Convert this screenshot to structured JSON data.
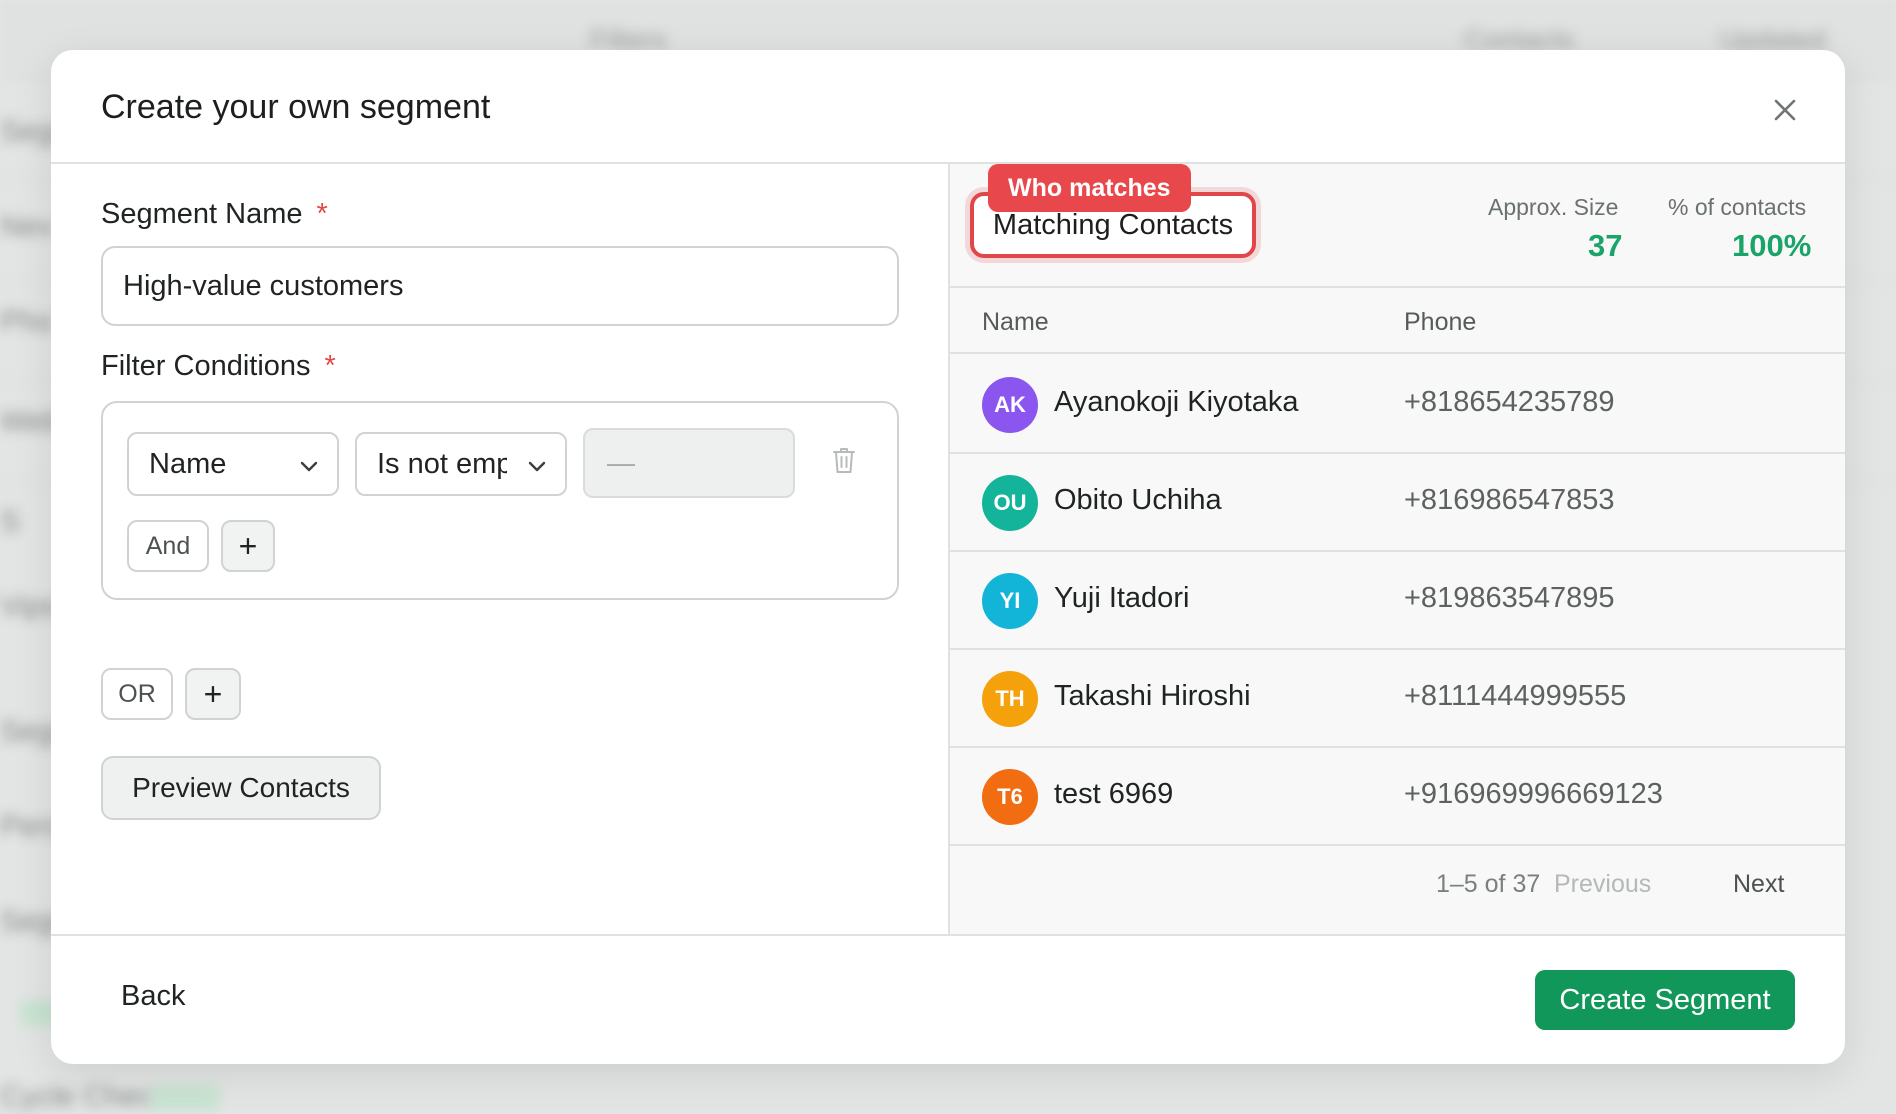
{
  "background": {
    "columns": [
      "Filters",
      "Contacts",
      "Updated"
    ],
    "rows": [
      "Segm",
      "Nev",
      "Pho",
      "Webs",
      "S",
      "Vips",
      "Segm",
      "Persc",
      "Segm",
      "Segm"
    ],
    "last_row_label": "Cycle Check"
  },
  "modal": {
    "title": "Create your own segment",
    "close_icon": "close-icon"
  },
  "form": {
    "segment_name_label": "Segment Name",
    "required_marker": "*",
    "segment_name_value": "High-value customers",
    "filter_conditions_label": "Filter Conditions",
    "condition": {
      "field": "Name",
      "operator": "Is not empty",
      "value_placeholder": "—"
    },
    "and_label": "And",
    "add_label": "+",
    "or_label": "OR",
    "preview_label": "Preview Contacts"
  },
  "results": {
    "tag": "Who matches",
    "title": "Matching Contacts",
    "approx_size_label": "Approx. Size",
    "approx_size_value": "37",
    "percent_label": "% of contacts",
    "percent_value": "100%",
    "columns": {
      "name": "Name",
      "phone": "Phone"
    },
    "contacts": [
      {
        "initials": "AK",
        "name": "Ayanokoji Kiyotaka",
        "phone": "+818654235789",
        "color": "#8b55f0"
      },
      {
        "initials": "OU",
        "name": "Obito Uchiha",
        "phone": "+816986547853",
        "color": "#14b49a"
      },
      {
        "initials": "YI",
        "name": "Yuji Itadori",
        "phone": "+819863547895",
        "color": "#12b4d8"
      },
      {
        "initials": "TH",
        "name": "Takashi Hiroshi",
        "phone": "+8111444999555",
        "color": "#f5a10c"
      },
      {
        "initials": "T6",
        "name": "test 6969",
        "phone": "+916969996669123",
        "color": "#f26c12"
      }
    ],
    "pagination": {
      "range": "1–5 of 37",
      "previous": "Previous",
      "next": "Next"
    }
  },
  "footer": {
    "back_label": "Back",
    "create_label": "Create Segment"
  },
  "colors": {
    "accent_green": "#11975a",
    "highlight_red": "#e8474b"
  }
}
